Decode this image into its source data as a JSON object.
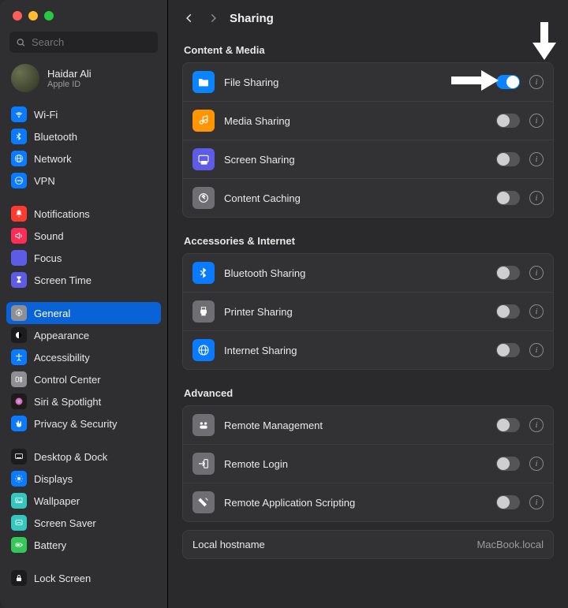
{
  "search": {
    "placeholder": "Search"
  },
  "account": {
    "name": "Haidar Ali",
    "sub": "Apple ID"
  },
  "sidebar": {
    "groups": [
      {
        "items": [
          {
            "label": "Wi-Fi",
            "icon": "wifi",
            "color": "#0a7aff"
          },
          {
            "label": "Bluetooth",
            "icon": "bt",
            "color": "#0a7aff"
          },
          {
            "label": "Network",
            "icon": "globe",
            "color": "#0a7aff"
          },
          {
            "label": "VPN",
            "icon": "vpn",
            "color": "#0a7aff"
          }
        ]
      },
      {
        "items": [
          {
            "label": "Notifications",
            "icon": "bell",
            "color": "#ff3b30"
          },
          {
            "label": "Sound",
            "icon": "sound",
            "color": "#ff2d55"
          },
          {
            "label": "Focus",
            "icon": "moon",
            "color": "#5e5ce6"
          },
          {
            "label": "Screen Time",
            "icon": "hour",
            "color": "#5e5ce6"
          }
        ]
      },
      {
        "items": [
          {
            "label": "General",
            "icon": "gear",
            "color": "#8e8e93",
            "selected": true
          },
          {
            "label": "Appearance",
            "icon": "appear",
            "color": "#1c1c1e"
          },
          {
            "label": "Accessibility",
            "icon": "access",
            "color": "#0a7aff"
          },
          {
            "label": "Control Center",
            "icon": "cc",
            "color": "#8e8e93"
          },
          {
            "label": "Siri & Spotlight",
            "icon": "siri",
            "color": "#1c1c1e"
          },
          {
            "label": "Privacy & Security",
            "icon": "hand",
            "color": "#0a7aff"
          }
        ]
      },
      {
        "items": [
          {
            "label": "Desktop & Dock",
            "icon": "dock",
            "color": "#1c1c1e"
          },
          {
            "label": "Displays",
            "icon": "disp",
            "color": "#0a7aff"
          },
          {
            "label": "Wallpaper",
            "icon": "wall",
            "color": "#34c7c0"
          },
          {
            "label": "Screen Saver",
            "icon": "ssaver",
            "color": "#34c7c0"
          },
          {
            "label": "Battery",
            "icon": "batt",
            "color": "#34c759"
          }
        ]
      },
      {
        "items": [
          {
            "label": "Lock Screen",
            "icon": "lock",
            "color": "#1c1c1e"
          }
        ]
      }
    ]
  },
  "header": {
    "title": "Sharing"
  },
  "sections": [
    {
      "title": "Content & Media",
      "rows": [
        {
          "label": "File Sharing",
          "icon": "folder",
          "color": "#0a84ff",
          "on": true
        },
        {
          "label": "Media Sharing",
          "icon": "media",
          "color": "#ff9500",
          "on": false
        },
        {
          "label": "Screen Sharing",
          "icon": "screen",
          "color": "#5e5ce6",
          "on": false
        },
        {
          "label": "Content Caching",
          "icon": "cache",
          "color": "#6f6f73",
          "on": false
        }
      ]
    },
    {
      "title": "Accessories & Internet",
      "rows": [
        {
          "label": "Bluetooth Sharing",
          "icon": "bt",
          "color": "#0a7aff",
          "on": false
        },
        {
          "label": "Printer Sharing",
          "icon": "print",
          "color": "#6f6f73",
          "on": false
        },
        {
          "label": "Internet Sharing",
          "icon": "globe",
          "color": "#0a7aff",
          "on": false
        }
      ]
    },
    {
      "title": "Advanced",
      "rows": [
        {
          "label": "Remote Management",
          "icon": "remote",
          "color": "#6f6f73",
          "on": false
        },
        {
          "label": "Remote Login",
          "icon": "login",
          "color": "#6f6f73",
          "on": false
        },
        {
          "label": "Remote Application Scripting",
          "icon": "script",
          "color": "#6f6f73",
          "on": false
        }
      ]
    }
  ],
  "hostname": {
    "label": "Local hostname",
    "value": "MacBook.local"
  }
}
